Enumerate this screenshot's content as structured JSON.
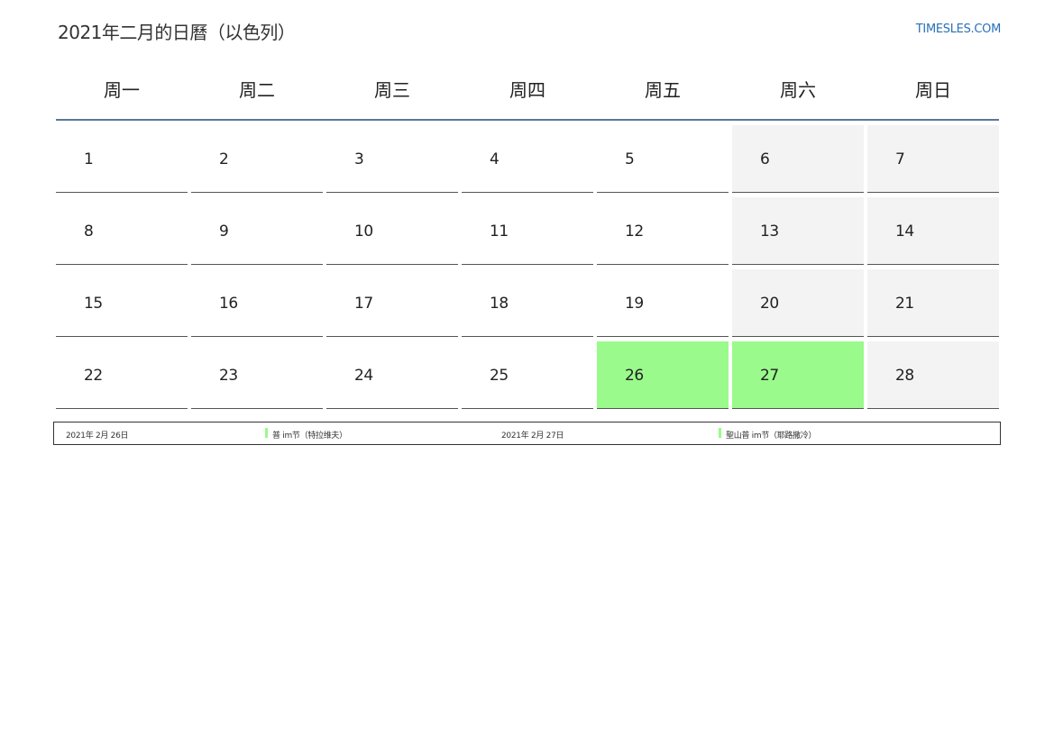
{
  "header": {
    "title": "2021年二月的日曆（以色列）",
    "brand": "TIMESLES.COM"
  },
  "calendar": {
    "weekdays": [
      "周一",
      "周二",
      "周三",
      "周四",
      "周五",
      "周六",
      "周日"
    ],
    "weeks": [
      [
        "1",
        "2",
        "3",
        "4",
        "5",
        "6",
        "7"
      ],
      [
        "8",
        "9",
        "10",
        "11",
        "12",
        "13",
        "14"
      ],
      [
        "15",
        "16",
        "17",
        "18",
        "19",
        "20",
        "21"
      ],
      [
        "22",
        "23",
        "24",
        "25",
        "26",
        "27",
        "28"
      ]
    ],
    "holiday_color": "#9afa8b",
    "weekend_color": "#f3f3f3",
    "holidays": [
      "26",
      "27"
    ]
  },
  "legend": {
    "items": [
      {
        "date": "2021年 2月 26日",
        "name": "普 im节（特拉维夫）"
      },
      {
        "date": "2021年 2月 27日",
        "name": "聖山普 im节（耶路撒冷）"
      }
    ]
  }
}
